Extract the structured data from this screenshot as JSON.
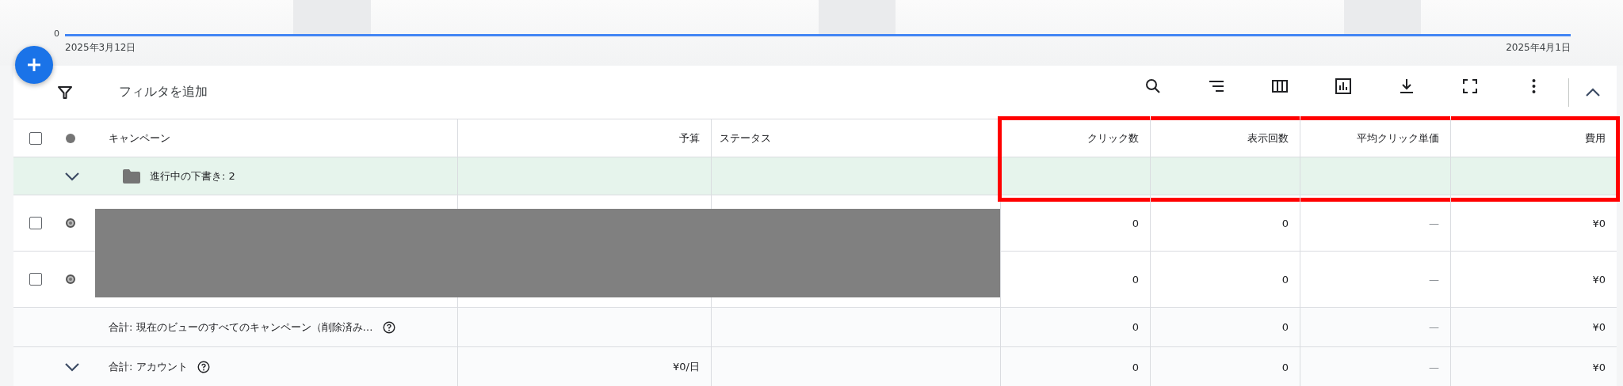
{
  "chart": {
    "y_tick": "0",
    "start_date": "2025年3月12日",
    "end_date": "2025年4月1日"
  },
  "filter": {
    "label": "フィルタを追加"
  },
  "columns": [
    {
      "label": "キャンペーン",
      "highlighted": false
    },
    {
      "label": "予算",
      "highlighted": false
    },
    {
      "label": "ステータス",
      "highlighted": false
    },
    {
      "label": "クリック数",
      "highlighted": true
    },
    {
      "label": "表示回数",
      "highlighted": true
    },
    {
      "label": "平均クリック単価",
      "highlighted": true
    },
    {
      "label": "費用",
      "highlighted": true
    }
  ],
  "header_checkbox": {
    "checked": false
  },
  "draft_group": {
    "label": "進行中の下書き: 2"
  },
  "rows": [
    {
      "checked": false,
      "redacted": true,
      "clicks": "0",
      "impressions": "0",
      "avg_cpc": "—",
      "cost": "¥0"
    },
    {
      "checked": false,
      "redacted": true,
      "clicks": "0",
      "impressions": "0",
      "avg_cpc": "—",
      "cost": "¥0"
    }
  ],
  "totals": [
    {
      "kind": "view",
      "label": "合計: 現在のビューのすべてのキャンペーン（削除済み…",
      "clicks": "0",
      "impressions": "0",
      "avg_cpc": "—",
      "cost": "¥0"
    },
    {
      "kind": "account",
      "label": "合計: アカウント",
      "budget": "¥0/日",
      "clicks": "0",
      "impressions": "0",
      "avg_cpc": "—",
      "cost": "¥0"
    }
  ]
}
